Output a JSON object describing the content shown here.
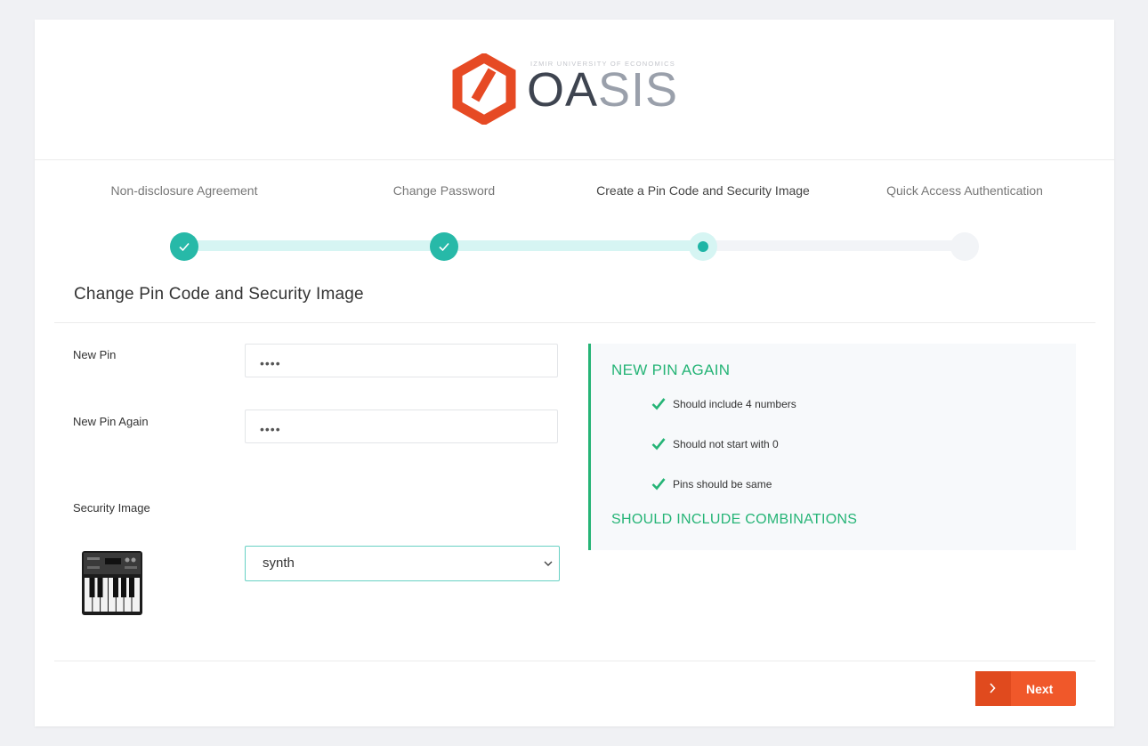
{
  "brand": {
    "university": "IZMIR UNIVERSITY OF ECONOMICS",
    "name_part1": "OA",
    "name_part2": "SIS",
    "colors": {
      "mark": "#e64a24",
      "dark": "#3e4450",
      "light": "#9aa0ab"
    }
  },
  "steps": [
    {
      "label": "Non-disclosure Agreement",
      "state": "done"
    },
    {
      "label": "Change Password",
      "state": "done"
    },
    {
      "label": "Create a Pin Code and Security Image",
      "state": "current"
    },
    {
      "label": "Quick Access Authentication",
      "state": "todo"
    }
  ],
  "section": {
    "title": "Change Pin Code and Security Image"
  },
  "form": {
    "new_pin": {
      "label": "New Pin",
      "value": "••••"
    },
    "new_pin_again": {
      "label": "New Pin Again",
      "value": "••••"
    },
    "security_image": {
      "label": "Security Image",
      "selected": "synth",
      "icon": "synth-keyboard-icon"
    }
  },
  "info": {
    "heading": "NEW PIN AGAIN",
    "rules": [
      "Should include 4 numbers",
      "Should not start with 0",
      "Pins should be same"
    ],
    "footer": "SHOULD INCLUDE COMBINATIONS",
    "accent": "#25b476"
  },
  "actions": {
    "next_label": "Next",
    "next_color": "#f0582a"
  },
  "colors": {
    "teal": "#27b9a8",
    "teal_light": "#d6f5f3"
  }
}
